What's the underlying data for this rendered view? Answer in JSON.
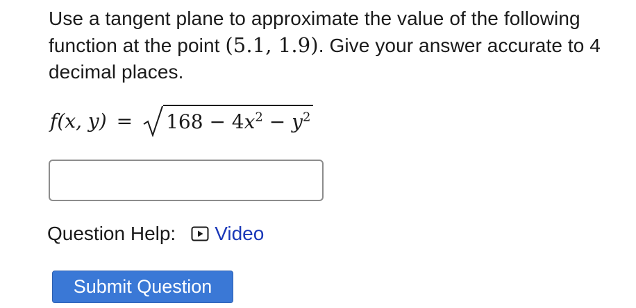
{
  "question": {
    "text_part1": "Use a tangent plane to approximate the value of the following function at the point ",
    "point": "(5.1, 1.9)",
    "text_part2": ". Give your answer accurate to 4 decimal places."
  },
  "formula": {
    "lhs": "f(x, y)",
    "equals": "=",
    "radicand_const": "168 − 4",
    "radicand_var1": "x",
    "radicand_exp1": "2",
    "radicand_minus": " − ",
    "radicand_var2": "y",
    "radicand_exp2": "2"
  },
  "answer": {
    "value": "",
    "placeholder": ""
  },
  "help": {
    "label": "Question Help:",
    "video_label": "Video",
    "icon": "video-play-icon"
  },
  "submit": {
    "label": "Submit Question"
  },
  "colors": {
    "link": "#1a38b8",
    "submit_bg": "#3a78d6",
    "input_border": "#8c8c8c"
  }
}
